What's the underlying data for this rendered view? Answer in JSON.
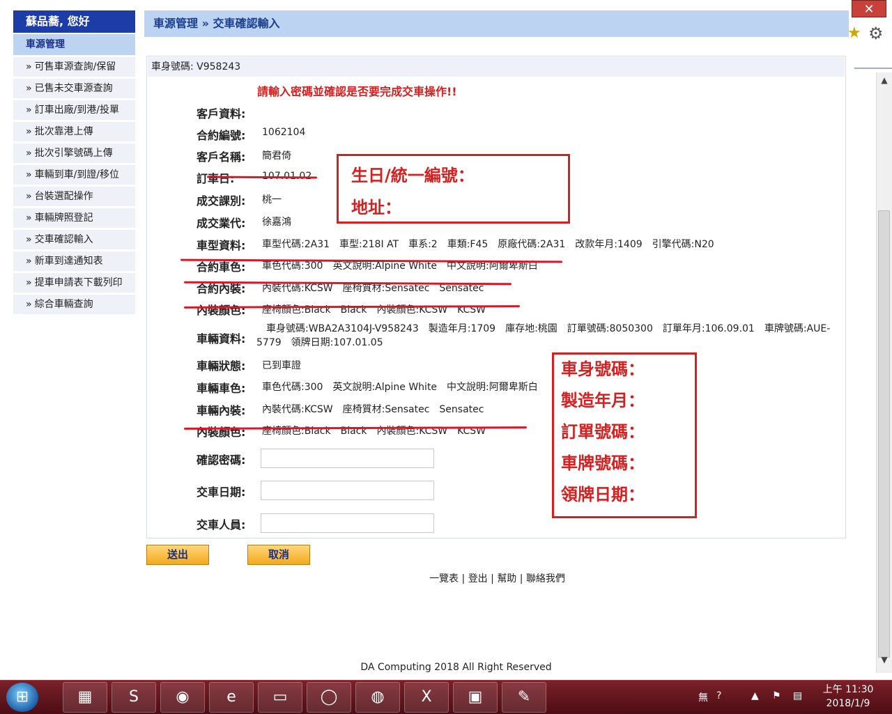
{
  "sidebar": {
    "greeting": "蘇品蕎, 您好",
    "section_title": "車源管理",
    "items": [
      "可售車源查詢/保留",
      "已售未交車源查詢",
      "訂車出廠/到港/投單",
      "批次靠港上傳",
      "批次引擎號碼上傳",
      "車輛到車/到證/移位",
      "台裝選配操作",
      "車輛牌照登記",
      "交車確認輸入",
      "新車到達通知表",
      "提車申請表下載列印",
      "綜合車輛查詢"
    ],
    "arrow": "»"
  },
  "header": {
    "breadcrumb": "車源管理 » 交車確認輸入"
  },
  "vin_header": "車身號碼: V958243",
  "confirm_message": "請輸入密碼並確認是否要完成交車操作!!",
  "fields": {
    "customer_info_label": "客戶資料:",
    "contract_no_label": "合約編號:",
    "contract_no": "1062104",
    "customer_name_label": "客戶名稱:",
    "customer_name": "簡君倚",
    "order_date_label": "訂車日:",
    "order_date": "107.01.02",
    "deal_class_label": "成交課別:",
    "deal_class": "桃一",
    "deal_agent_label": "成交業代:",
    "deal_agent": "徐嘉鴻",
    "model_info_label": "車型資料:",
    "model_info": "車型代碼:2A31　車型:218I AT　車系:2　車類:F45　原廠代碼:2A31　改款年月:1409　引擎代碼:N20",
    "contract_color_label": "合約車色:",
    "contract_color": "車色代碼:300　英文說明:Alpine White　中文說明:阿爾卑斯白",
    "contract_interior_label": "合約內裝:",
    "contract_interior": "內裝代碼:KCSW　座椅質材:Sensatec　Sensatec",
    "interior_color_label": "內裝顏色:",
    "interior_color": "座椅顏色:Black　Black　內裝顏色:KCSW　KCSW",
    "vehicle_info_label": "車輛資料:",
    "vehicle_info": "　車身號碼:WBA2A3104J-V958243　製造年月:1709　庫存地:桃園　訂單號碼:8050300　訂單年月:106.09.01　車牌號碼:AUE-5779　領牌日期:107.01.05",
    "vehicle_status_label": "車輛狀態:",
    "vehicle_status": "已到車證",
    "vehicle_color_label": "車輛車色:",
    "vehicle_color": "車色代碼:300　英文說明:Alpine White　中文說明:阿爾卑斯白",
    "vehicle_interior_label": "車輛內裝:",
    "vehicle_interior": "內裝代碼:KCSW　座椅質材:Sensatec　Sensatec",
    "interior_color2_label": "內裝顏色:",
    "interior_color2": "座椅顏色:Black　Black　內裝顏色:KCSW　KCSW",
    "password_label": "確認密碼:",
    "password_value": "",
    "delivery_date_label": "交車日期:",
    "delivery_date_value": "",
    "delivery_staff_label": "交車人員:",
    "delivery_staff_value": ""
  },
  "buttons": {
    "submit": "送出",
    "cancel": "取消"
  },
  "footer": {
    "links": [
      "一覽表",
      "登出",
      "幫助",
      "聯絡我們"
    ],
    "separator": " | ",
    "copyright": "DA Computing 2018 All Right Reserved"
  },
  "annotations": {
    "box1": [
      "生日/統一編號：",
      "地址："
    ],
    "box2": [
      "車身號碼：",
      "製造年月：",
      "訂單號碼：",
      "車牌號碼：",
      "領牌日期："
    ]
  },
  "window": {
    "close": "✕"
  },
  "taskbar": {
    "apps": [
      "explorer-icon",
      "skype-icon",
      "chrome-icon",
      "ie-icon",
      "folder-icon",
      "whatsapp-icon",
      "line-icon",
      "excel-icon",
      "photos-icon",
      "paint-icon"
    ],
    "ime": "無",
    "time": "上午 11:30",
    "date": "2018/1/9"
  },
  "colors": {
    "header_bg": "#bcd4f2",
    "greeting_bg": "#1c3ca8",
    "annotation_red": "#d42020",
    "button_orange": "#f3a91e",
    "taskbar": "#6b1a22"
  }
}
